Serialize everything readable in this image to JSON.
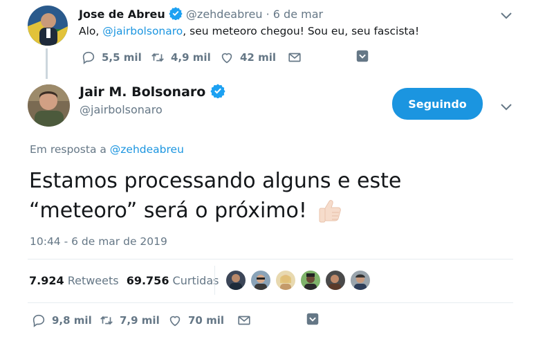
{
  "parent_tweet": {
    "author_name": "Jose de Abreu",
    "handle": "@zehdeabreu",
    "separator": "·",
    "date": "6 de mar",
    "text_prefix": "Alo, ",
    "mention": "@jairbolsonaro",
    "text_suffix": ", seu meteoro chegou! Sou eu, seu fascista!",
    "replies": "5,5 mil",
    "retweets": "4,9 mil",
    "likes": "42 mil"
  },
  "main_tweet": {
    "author_name": "Jair M. Bolsonaro",
    "handle": "@jairbolsonaro",
    "follow_label": "Seguindo",
    "reply_prefix": "Em resposta a ",
    "reply_to": "@zehdeabreu",
    "text_line1": "Estamos processando alguns e este",
    "text_line2": "“meteoro” será o próximo!",
    "timestamp": "10:44 - 6 de mar de 2019",
    "retweet_count": "7.924",
    "retweet_label": "Retweets",
    "like_count": "69.756",
    "like_label": "Curtidas",
    "replies": "9,8 mil",
    "retweets": "7,9 mil",
    "likes": "70 mil"
  },
  "colors": {
    "accent": "#1b95e0",
    "muted": "#657786",
    "divider": "#e6ecf0"
  },
  "icons": [
    "verified-badge-icon",
    "chevron-down-icon",
    "reply-icon",
    "retweet-icon",
    "like-icon",
    "direct-message-icon",
    "save-icon",
    "thumbs-up-emoji"
  ]
}
